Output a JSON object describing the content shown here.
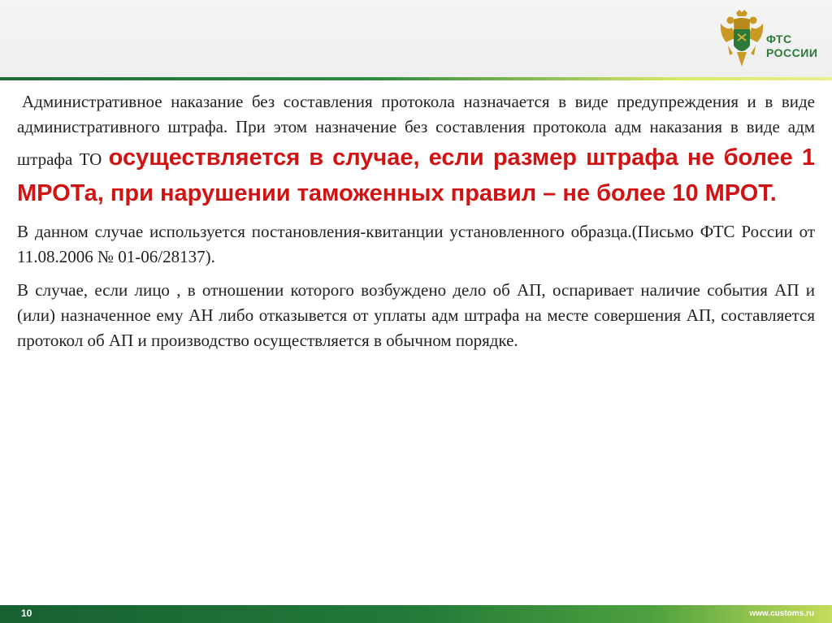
{
  "header": {
    "logo": {
      "line1": "ФТС",
      "line2": "РОССИИ",
      "emblem_icon": "double-headed-eagle-icon",
      "brand_color": "#2b7a3a"
    },
    "accent_color": "#2f8a3f"
  },
  "content": {
    "p1_normal": "Административное наказание без составления протокола назначается в виде предупреждения и в виде административного штрафа. При этом назначение без составления протокола адм наказания в виде адм штрафа ТО ",
    "p1_emphasis": "осуществляется в случае, если размер штрафа не более 1 МРОТа, при нарушении таможенных правил – не более 10 МРОТ.",
    "emphasis_color": "#d11313",
    "p2": "В данном случае используется постановления-квитанции установленного образца.(Письмо ФТС России от 11.08.2006 № 01-06/28137).",
    "p3": "В случае, если лицо , в отношении которого возбуждено дело об АП, оспаривает наличие события АП и (или) назначенное ему АН либо отказывется от уплаты адм штрафа на месте совершения АП, составляется протокол об АП и производство осуществляется в обычном порядке."
  },
  "footer": {
    "page_number": "10",
    "site": "www.customs.ru"
  }
}
